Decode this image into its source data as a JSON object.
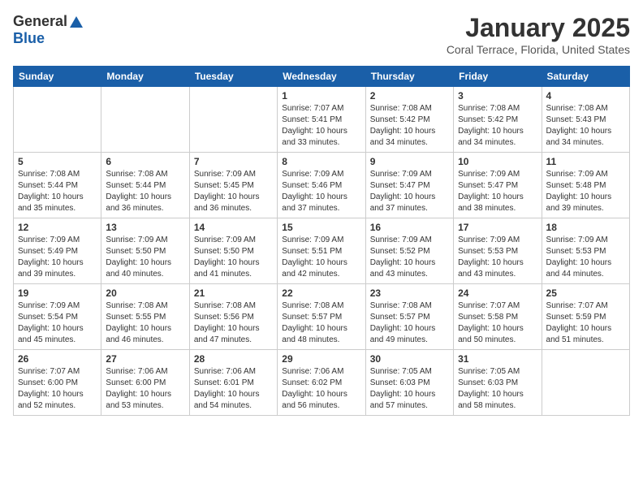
{
  "header": {
    "logo_general": "General",
    "logo_blue": "Blue",
    "title": "January 2025",
    "location": "Coral Terrace, Florida, United States"
  },
  "calendar": {
    "days_of_week": [
      "Sunday",
      "Monday",
      "Tuesday",
      "Wednesday",
      "Thursday",
      "Friday",
      "Saturday"
    ],
    "weeks": [
      [
        {
          "day": "",
          "info": "",
          "empty": true
        },
        {
          "day": "",
          "info": "",
          "empty": true
        },
        {
          "day": "",
          "info": "",
          "empty": true
        },
        {
          "day": "1",
          "info": "Sunrise: 7:07 AM\nSunset: 5:41 PM\nDaylight: 10 hours\nand 33 minutes.",
          "empty": false
        },
        {
          "day": "2",
          "info": "Sunrise: 7:08 AM\nSunset: 5:42 PM\nDaylight: 10 hours\nand 34 minutes.",
          "empty": false
        },
        {
          "day": "3",
          "info": "Sunrise: 7:08 AM\nSunset: 5:42 PM\nDaylight: 10 hours\nand 34 minutes.",
          "empty": false
        },
        {
          "day": "4",
          "info": "Sunrise: 7:08 AM\nSunset: 5:43 PM\nDaylight: 10 hours\nand 34 minutes.",
          "empty": false
        }
      ],
      [
        {
          "day": "5",
          "info": "Sunrise: 7:08 AM\nSunset: 5:44 PM\nDaylight: 10 hours\nand 35 minutes.",
          "empty": false
        },
        {
          "day": "6",
          "info": "Sunrise: 7:08 AM\nSunset: 5:44 PM\nDaylight: 10 hours\nand 36 minutes.",
          "empty": false
        },
        {
          "day": "7",
          "info": "Sunrise: 7:09 AM\nSunset: 5:45 PM\nDaylight: 10 hours\nand 36 minutes.",
          "empty": false
        },
        {
          "day": "8",
          "info": "Sunrise: 7:09 AM\nSunset: 5:46 PM\nDaylight: 10 hours\nand 37 minutes.",
          "empty": false
        },
        {
          "day": "9",
          "info": "Sunrise: 7:09 AM\nSunset: 5:47 PM\nDaylight: 10 hours\nand 37 minutes.",
          "empty": false
        },
        {
          "day": "10",
          "info": "Sunrise: 7:09 AM\nSunset: 5:47 PM\nDaylight: 10 hours\nand 38 minutes.",
          "empty": false
        },
        {
          "day": "11",
          "info": "Sunrise: 7:09 AM\nSunset: 5:48 PM\nDaylight: 10 hours\nand 39 minutes.",
          "empty": false
        }
      ],
      [
        {
          "day": "12",
          "info": "Sunrise: 7:09 AM\nSunset: 5:49 PM\nDaylight: 10 hours\nand 39 minutes.",
          "empty": false
        },
        {
          "day": "13",
          "info": "Sunrise: 7:09 AM\nSunset: 5:50 PM\nDaylight: 10 hours\nand 40 minutes.",
          "empty": false
        },
        {
          "day": "14",
          "info": "Sunrise: 7:09 AM\nSunset: 5:50 PM\nDaylight: 10 hours\nand 41 minutes.",
          "empty": false
        },
        {
          "day": "15",
          "info": "Sunrise: 7:09 AM\nSunset: 5:51 PM\nDaylight: 10 hours\nand 42 minutes.",
          "empty": false
        },
        {
          "day": "16",
          "info": "Sunrise: 7:09 AM\nSunset: 5:52 PM\nDaylight: 10 hours\nand 43 minutes.",
          "empty": false
        },
        {
          "day": "17",
          "info": "Sunrise: 7:09 AM\nSunset: 5:53 PM\nDaylight: 10 hours\nand 43 minutes.",
          "empty": false
        },
        {
          "day": "18",
          "info": "Sunrise: 7:09 AM\nSunset: 5:53 PM\nDaylight: 10 hours\nand 44 minutes.",
          "empty": false
        }
      ],
      [
        {
          "day": "19",
          "info": "Sunrise: 7:09 AM\nSunset: 5:54 PM\nDaylight: 10 hours\nand 45 minutes.",
          "empty": false
        },
        {
          "day": "20",
          "info": "Sunrise: 7:08 AM\nSunset: 5:55 PM\nDaylight: 10 hours\nand 46 minutes.",
          "empty": false
        },
        {
          "day": "21",
          "info": "Sunrise: 7:08 AM\nSunset: 5:56 PM\nDaylight: 10 hours\nand 47 minutes.",
          "empty": false
        },
        {
          "day": "22",
          "info": "Sunrise: 7:08 AM\nSunset: 5:57 PM\nDaylight: 10 hours\nand 48 minutes.",
          "empty": false
        },
        {
          "day": "23",
          "info": "Sunrise: 7:08 AM\nSunset: 5:57 PM\nDaylight: 10 hours\nand 49 minutes.",
          "empty": false
        },
        {
          "day": "24",
          "info": "Sunrise: 7:07 AM\nSunset: 5:58 PM\nDaylight: 10 hours\nand 50 minutes.",
          "empty": false
        },
        {
          "day": "25",
          "info": "Sunrise: 7:07 AM\nSunset: 5:59 PM\nDaylight: 10 hours\nand 51 minutes.",
          "empty": false
        }
      ],
      [
        {
          "day": "26",
          "info": "Sunrise: 7:07 AM\nSunset: 6:00 PM\nDaylight: 10 hours\nand 52 minutes.",
          "empty": false
        },
        {
          "day": "27",
          "info": "Sunrise: 7:06 AM\nSunset: 6:00 PM\nDaylight: 10 hours\nand 53 minutes.",
          "empty": false
        },
        {
          "day": "28",
          "info": "Sunrise: 7:06 AM\nSunset: 6:01 PM\nDaylight: 10 hours\nand 54 minutes.",
          "empty": false
        },
        {
          "day": "29",
          "info": "Sunrise: 7:06 AM\nSunset: 6:02 PM\nDaylight: 10 hours\nand 56 minutes.",
          "empty": false
        },
        {
          "day": "30",
          "info": "Sunrise: 7:05 AM\nSunset: 6:03 PM\nDaylight: 10 hours\nand 57 minutes.",
          "empty": false
        },
        {
          "day": "31",
          "info": "Sunrise: 7:05 AM\nSunset: 6:03 PM\nDaylight: 10 hours\nand 58 minutes.",
          "empty": false
        },
        {
          "day": "",
          "info": "",
          "empty": true
        }
      ]
    ]
  }
}
